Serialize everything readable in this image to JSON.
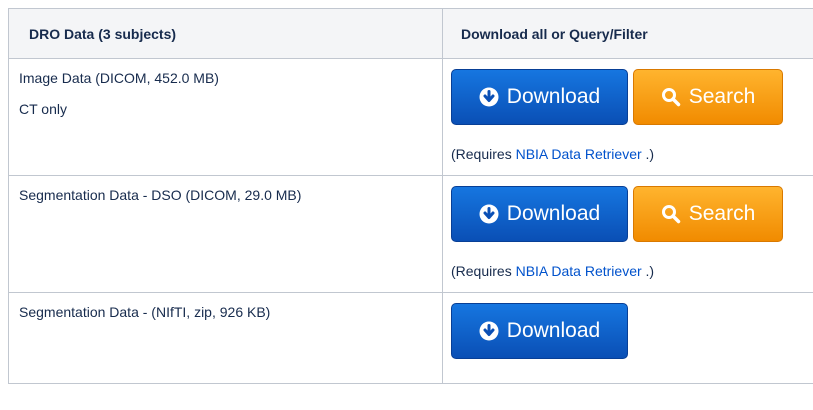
{
  "table": {
    "headers": [
      "DRO Data (3 subjects)",
      "Download all or Query/Filter"
    ],
    "rows": [
      {
        "label": "Image Data (DICOM, 452.0 MB)",
        "note": "CT only",
        "download_label": "Download",
        "search_label": "Search",
        "requires_prefix": "(Requires ",
        "requires_link": "NBIA Data Retriever",
        "requires_suffix": " .)"
      },
      {
        "label": "Segmentation Data - DSO (DICOM, 29.0 MB)",
        "download_label": "Download",
        "search_label": "Search",
        "requires_prefix": "(Requires ",
        "requires_link": "NBIA Data Retriever",
        "requires_suffix": " .)"
      },
      {
        "label": "Segmentation Data - (NIfTI, zip, 926 KB)",
        "download_label": "Download"
      }
    ]
  },
  "colors": {
    "download_button": "#0a4fb5",
    "search_button": "#f18b00",
    "link": "#0052cc",
    "header_bg": "#f4f5f7"
  },
  "icons": {
    "download": "download-circle-icon",
    "search": "magnifier-icon"
  }
}
